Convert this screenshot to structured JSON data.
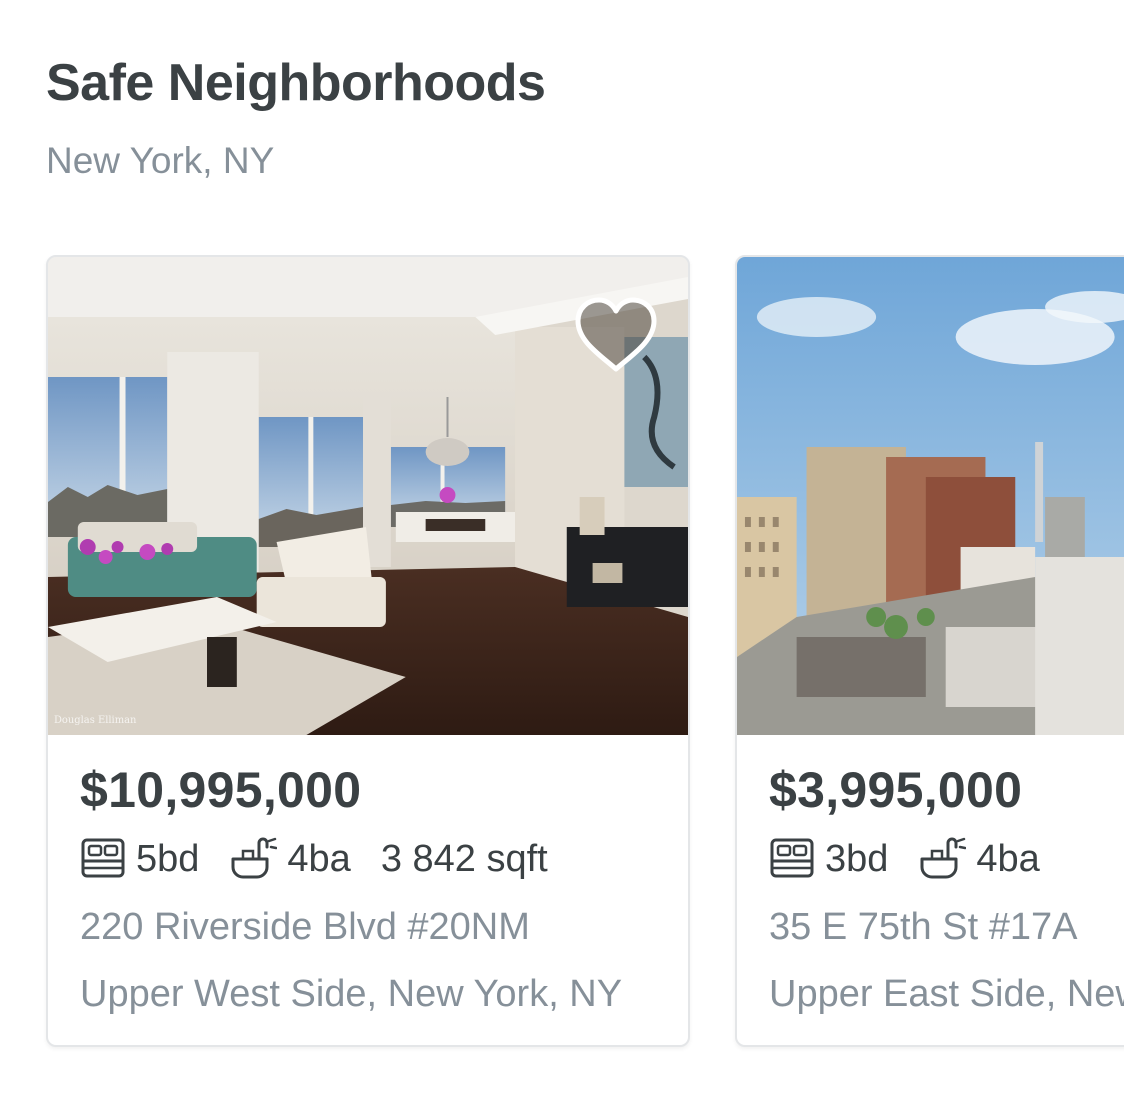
{
  "section": {
    "title": "Safe Neighborhoods",
    "location": "New York, NY"
  },
  "listings": [
    {
      "price": "$10,995,000",
      "beds": "5bd",
      "baths": "4ba",
      "sqft": "3 842 sqft",
      "address": "220 Riverside Blvd #20NM",
      "neighborhood": "Upper West Side, New York, NY",
      "photo_watermark": "Douglas Elliman",
      "favorite_icon": "heart-icon"
    },
    {
      "price": "$3,995,000",
      "beds": "3bd",
      "baths": "4ba",
      "address": "35 E 75th St #17A",
      "neighborhood": "Upper East Side, New York, NY"
    }
  ],
  "icons": {
    "beds": "bed-icon",
    "baths": "bathtub-icon",
    "favorite": "heart-icon"
  },
  "colors": {
    "heading": "#3b4144",
    "muted": "#869099",
    "card_border": "#e4e6e8"
  }
}
